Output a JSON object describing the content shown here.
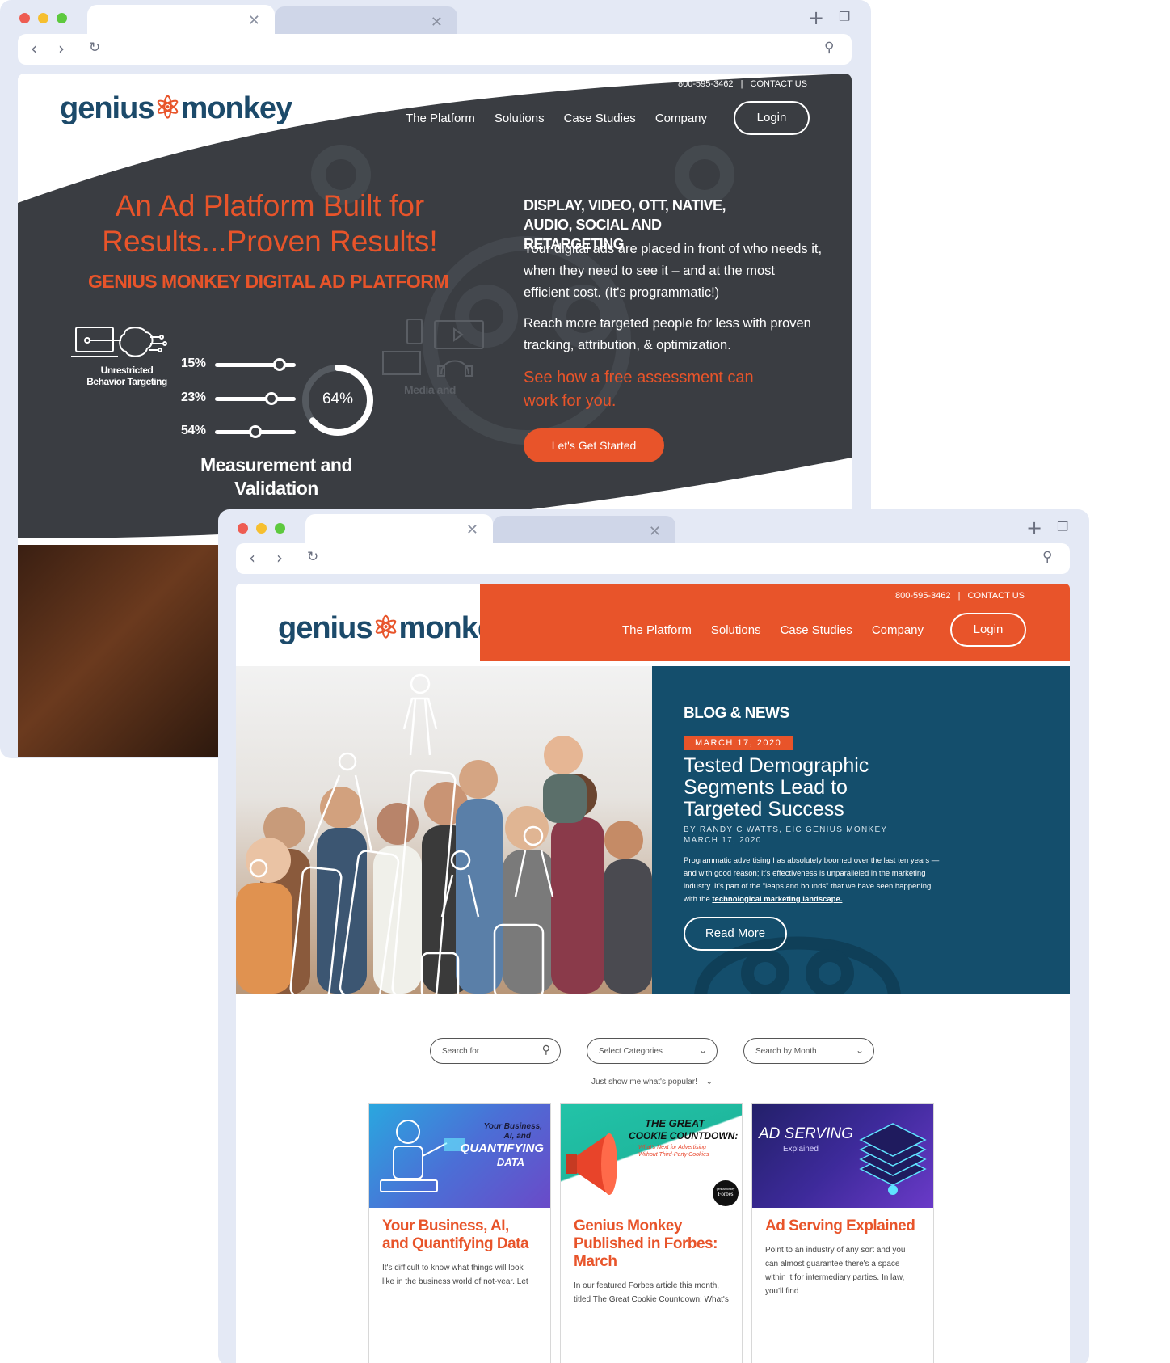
{
  "back_window": {
    "address_bar": {
      "value": ""
    },
    "header": {
      "phone": "800-595-3462",
      "separator": "|",
      "contact": "CONTACT US",
      "nav": [
        "The Platform",
        "Solutions",
        "Case Studies",
        "Company"
      ],
      "login": "Login",
      "logo_text_left": "genius",
      "logo_text_right": "monkey"
    },
    "hero": {
      "headline": "An Ad Platform Built for Results...Proven Results!",
      "subhead": "GENIUS MONKEY DIGITAL AD PLATFORM",
      "behavior_label": "Unrestricted Behavior Targeting",
      "sliders": [
        {
          "label": "15%",
          "value": 0.8
        },
        {
          "label": "23%",
          "value": 0.7
        },
        {
          "label": "54%",
          "value": 0.5
        }
      ],
      "gauge": {
        "label": "64%",
        "value": 0.64
      },
      "measurement": "Measurement and Validation",
      "media_label": "Media and",
      "channels": "DISPLAY, VIDEO, OTT, NATIVE, AUDIO, SOCIAL AND RETARGETING",
      "para1": "Your digital ads are placed in front of who needs it, when they need to see it – and at the most efficient cost. (It's programmatic!)",
      "para2": "Reach more targeted people for less with proven tracking, attribution, & optimization.",
      "cta_text": "See how a free assessment can work for you.",
      "cta_button": "Let's Get Started"
    }
  },
  "front_window": {
    "address_bar": {
      "value": ""
    },
    "header": {
      "phone": "800-595-3462",
      "separator": "|",
      "contact": "CONTACT US",
      "nav": [
        "The Platform",
        "Solutions",
        "Case Studies",
        "Company"
      ],
      "login": "Login",
      "logo_text_left": "genius",
      "logo_text_right": "monkey"
    },
    "feature": {
      "section": "BLOG & NEWS",
      "date_badge": "MARCH 17, 2020",
      "title": "Tested Demographic Segments Lead to Targeted Success",
      "byline": "BY RANDY C WATTS, EIC GENIUS MONKEY",
      "byline_date": "MARCH 17, 2020",
      "excerpt": "Programmatic advertising has absolutely boomed over the last ten years — and with good reason; it's effectiveness is unparalleled in the marketing industry. It's part of the \"leaps and bounds\" that we have seen happening with the",
      "excerpt_link": "technological marketing landscape.",
      "read_more": "Read More"
    },
    "filters": {
      "search_placeholder": "Search for",
      "categories": "Select Categories",
      "month": "Search by Month",
      "popular": "Just show me what's popular!"
    },
    "cards": [
      {
        "image_caption_1": "Your Business,",
        "image_caption_2": "AI, and",
        "image_caption_3": "QUANTIFYING",
        "image_caption_4": "DATA",
        "title": "Your Business, AI, and Quantifying Data",
        "text": "It's difficult to know what things will look like in the business world of not-year. Let"
      },
      {
        "image_caption_1": "THE GREAT",
        "image_caption_2": "COOKIE COUNTDOWN:",
        "image_caption_3": "What's Next for Advertising",
        "image_caption_4": "Without Third-Party Cookies",
        "badge_line1": "geniusmonkey",
        "badge_line2": "Forbes",
        "title": "Genius Monkey Published in Forbes: March",
        "text": "In our featured Forbes article this month, titled The Great Cookie Countdown: What's"
      },
      {
        "image_caption_1": "AD SERVING",
        "image_caption_2": "Explained",
        "title": "Ad Serving Explained",
        "text": "Point to an industry of any sort and you can almost guarantee there's a space within it for intermediary parties. In law, you'll find"
      }
    ]
  },
  "colors": {
    "orange": "#e8542a",
    "dark": "#3a3d42",
    "navy": "#144e6c",
    "frame": "#e4e9f5"
  }
}
